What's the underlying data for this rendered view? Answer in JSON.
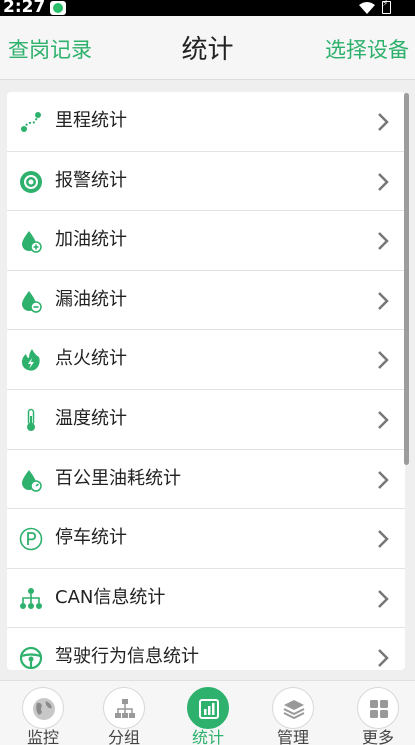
{
  "status_bar": {
    "time": "2:27"
  },
  "header": {
    "left_action": "查岗记录",
    "title": "统计",
    "right_action": "选择设备"
  },
  "list": {
    "items": [
      {
        "label": "里程统计",
        "icon": "route-icon"
      },
      {
        "label": "报警统计",
        "icon": "alarm-icon"
      },
      {
        "label": "加油统计",
        "icon": "fuel-add-icon"
      },
      {
        "label": "漏油统计",
        "icon": "fuel-leak-icon"
      },
      {
        "label": "点火统计",
        "icon": "ignition-icon"
      },
      {
        "label": "温度统计",
        "icon": "thermometer-icon"
      },
      {
        "label": "百公里油耗统计",
        "icon": "fuel-consumption-icon"
      },
      {
        "label": "停车统计",
        "icon": "parking-icon"
      },
      {
        "label": "CAN信息统计",
        "icon": "can-network-icon"
      },
      {
        "label": "驾驶行为信息统计",
        "icon": "steering-wheel-icon"
      }
    ]
  },
  "bottom_nav": {
    "items": [
      {
        "label": "监控",
        "icon": "globe-icon",
        "active": false
      },
      {
        "label": "分组",
        "icon": "group-tree-icon",
        "active": false
      },
      {
        "label": "统计",
        "icon": "stats-chart-icon",
        "active": true
      },
      {
        "label": "管理",
        "icon": "layers-icon",
        "active": false
      },
      {
        "label": "更多",
        "icon": "grid-more-icon",
        "active": false
      }
    ]
  },
  "colors": {
    "accent": "#2db16c",
    "text": "#222222",
    "background": "#efefef"
  }
}
